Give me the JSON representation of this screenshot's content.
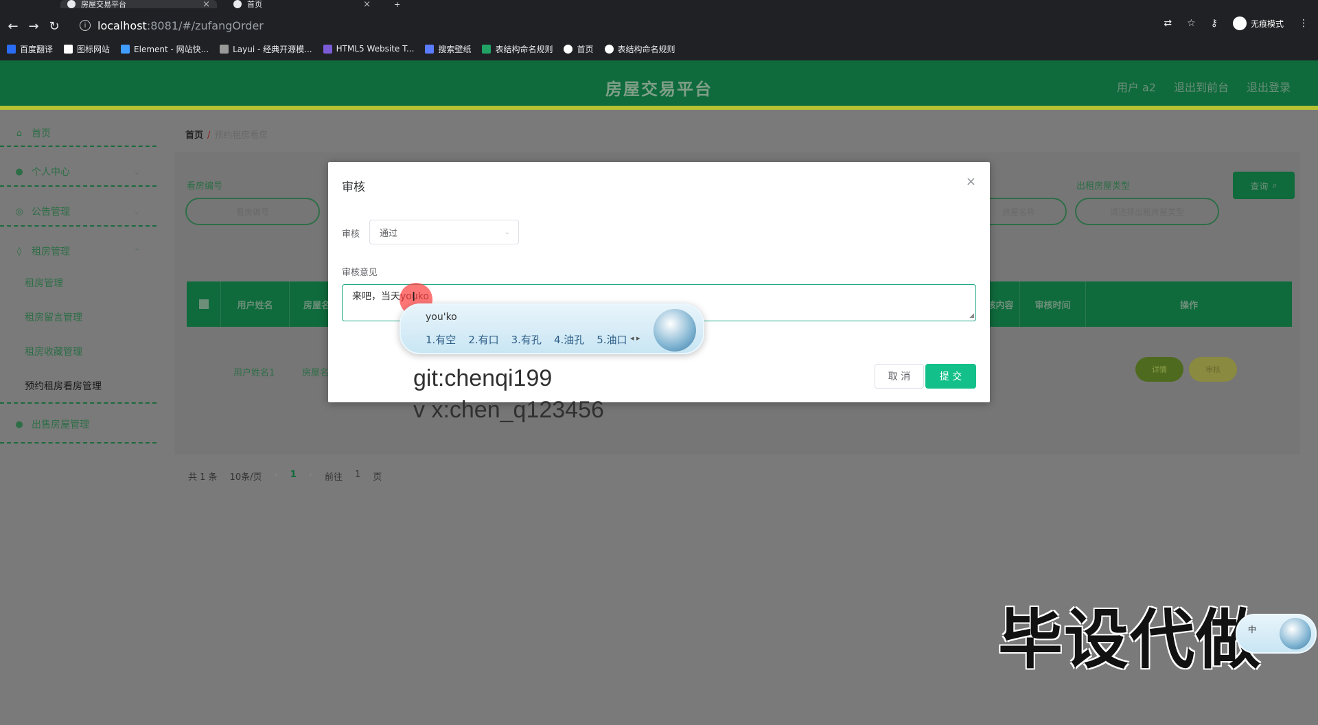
{
  "browser": {
    "tabs": [
      {
        "label": "房屋交易平台",
        "active": true
      },
      {
        "label": "首页",
        "active": false
      }
    ],
    "url_host": "localhost",
    "url_path": ":8081/#/zufangOrder",
    "incognito_label": "无痕模式",
    "bookmarks": [
      {
        "label": "百度翻译",
        "color": "#2a6df4"
      },
      {
        "label": "图标网站",
        "color": "#ffffff"
      },
      {
        "label": "Element - 网站快...",
        "color": "#409eff"
      },
      {
        "label": "Layui - 经典开源模...",
        "color": "#999999"
      },
      {
        "label": "HTML5 Website T...",
        "color": "#7b5cd6"
      },
      {
        "label": "搜索壁纸",
        "color": "#5b7cff"
      },
      {
        "label": "表结构命名规则",
        "color": "#21a366"
      },
      {
        "label": "首页",
        "color": "#ffffff"
      },
      {
        "label": "表结构命名规则",
        "color": "#ffffff"
      }
    ]
  },
  "header": {
    "title": "房屋交易平台",
    "links": [
      "用户 a2",
      "退出到前台",
      "退出登录"
    ]
  },
  "sidebar": {
    "items": [
      {
        "label": "首页",
        "icon": "home-icon"
      },
      {
        "label": "个人中心",
        "icon": "user-icon"
      },
      {
        "label": "公告管理",
        "icon": "bell-icon"
      },
      {
        "label": "租房管理",
        "icon": "pin-icon"
      },
      {
        "label": "出售房屋管理",
        "icon": "drop-icon"
      }
    ],
    "subitems": [
      "租房管理",
      "租房留言管理",
      "租房收藏管理",
      "预约租房看房管理"
    ]
  },
  "breadcrumb": {
    "home": "首页",
    "current": "预约租房看房"
  },
  "filters": {
    "field1_label": "看房编号",
    "field1_placeholder": "看房编号",
    "field3_placeholder": "房屋名称",
    "field4_label": "出租房屋类型",
    "field4_placeholder": "请选择出租房屋类型",
    "search_label": "查询"
  },
  "table": {
    "headers": [
      "用户姓名",
      "房屋名",
      "审核内容",
      "审核时间",
      "操作"
    ],
    "row": {
      "user": "用户姓名1",
      "house": "房屋名"
    },
    "row_buttons": [
      "详情",
      "审核"
    ]
  },
  "pagination": {
    "total": "共 1 条",
    "page_size": "10条/页",
    "current": "1",
    "goto_label": "前往",
    "goto_value": "1",
    "page_unit": "页"
  },
  "dialog": {
    "title": "审核",
    "status_label": "审核",
    "status_value": "通过",
    "comment_label": "审核意见",
    "comment_value": "来吧，当天youko",
    "cancel_label": "取 消",
    "submit_label": "提 交"
  },
  "ime": {
    "composition": "you'ko",
    "candidates": [
      "1.有空",
      "2.有口",
      "3.有孔",
      "4.油孔",
      "5.油口"
    ],
    "float_label": "中"
  },
  "overlays": {
    "git": "git:chenqi199",
    "vx": "v x:chen_q123456",
    "banner": "毕设代做"
  }
}
